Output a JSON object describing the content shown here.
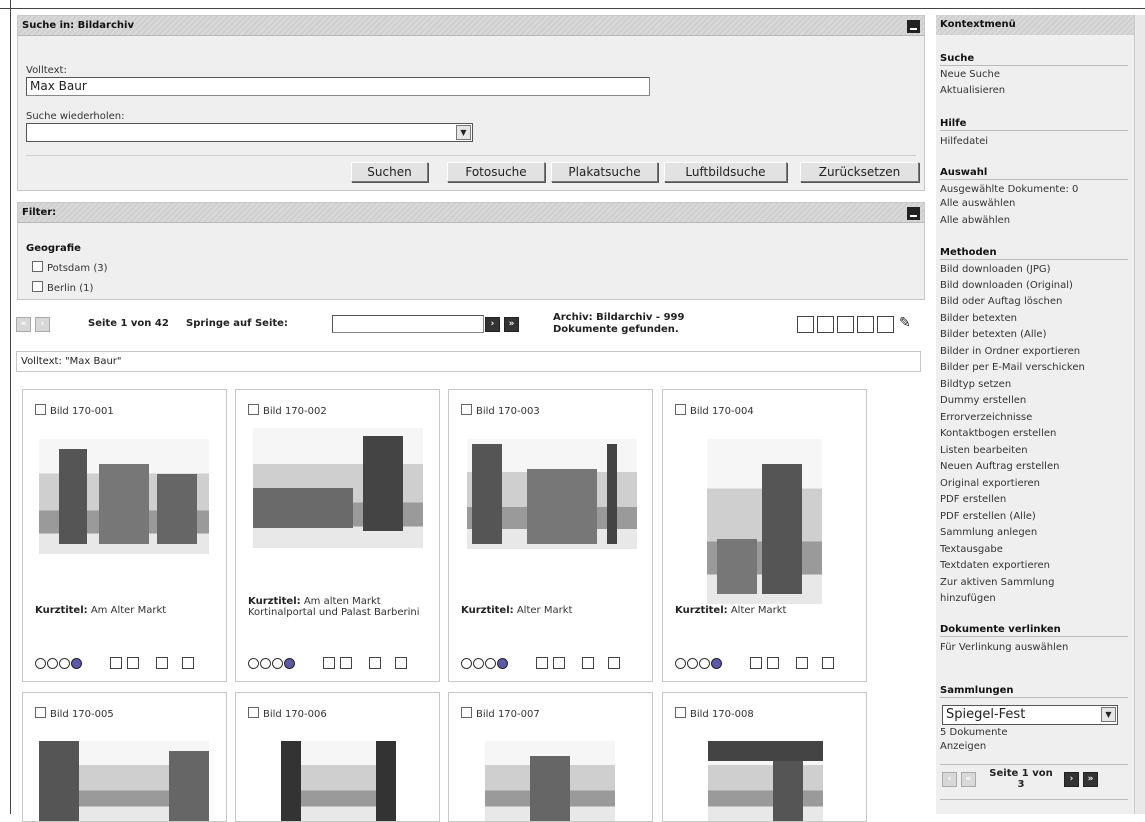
{
  "search": {
    "header": "Suche in: Bildarchiv",
    "volltext_label": "Volltext:",
    "volltext_value": "Max Baur",
    "repeat_label": "Suche wiederholen:",
    "repeat_value": "",
    "buttons": [
      "Suchen",
      "Fotosuche",
      "Plakatsuche",
      "Luftbildsuche",
      "Zurücksetzen"
    ]
  },
  "filter": {
    "header": "Filter:",
    "group_title": "Geografie",
    "options": [
      "Potsdam (3)",
      "Berlin (1)"
    ]
  },
  "pager": {
    "page_text": "Seite 1 von 42",
    "jump_label": "Springe auf Seite:",
    "archive_line1": "Archiv: Bildarchiv - 999",
    "archive_line2": "Dokumente gefunden."
  },
  "criteria": "Volltext: \"Max Baur\"",
  "results": [
    {
      "id": "Bild 170-001",
      "label": "Kurztitel:",
      "title": "Am Alter Markt"
    },
    {
      "id": "Bild 170-002",
      "label": "Kurztitel:",
      "title": "Am alten Markt Kortinalportal und Palast Barberini"
    },
    {
      "id": "Bild 170-003",
      "label": "Kurztitel:",
      "title": "Alter Markt"
    },
    {
      "id": "Bild 170-004",
      "label": "Kurztitel:",
      "title": "Alter Markt"
    },
    {
      "id": "Bild 170-005",
      "label": "",
      "title": ""
    },
    {
      "id": "Bild 170-006",
      "label": "",
      "title": ""
    },
    {
      "id": "Bild 170-007",
      "label": "",
      "title": ""
    },
    {
      "id": "Bild 170-008",
      "label": "",
      "title": ""
    }
  ],
  "sidebar": {
    "header": "Kontextmenü",
    "suche_title": "Suche",
    "suche_items": [
      "Neue Suche",
      "Aktualisieren"
    ],
    "hilfe_title": "Hilfe",
    "hilfe_items": [
      "Hilfedatei"
    ],
    "auswahl_title": "Auswahl",
    "auswahl_items": [
      "Ausgewählte Dokumente: 0",
      "Alle auswählen",
      "Alle abwählen"
    ],
    "methoden_title": "Methoden",
    "methoden_items": [
      "Bild downloaden (JPG)",
      "Bild downloaden (Original)",
      "Bild oder Auftag löschen",
      "Bilder betexten",
      "Bilder betexten (Alle)",
      "Bilder in Ordner exportieren",
      "Bilder per E-Mail verschicken",
      "Bildtyp setzen",
      "Dummy erstellen",
      "Errorverzeichnisse",
      "Kontaktbogen erstellen",
      "Listen bearbeiten",
      "Neuen Auftrag erstellen",
      "Original exportieren",
      "PDF erstellen",
      "PDF erstellen (Alle)",
      "Sammlung anlegen",
      "Textausgabe",
      "Textdaten exportieren",
      "Zur aktiven Sammlung",
      "hinzufügen"
    ],
    "verlinken_title": "Dokumente verlinken",
    "verlinken_items": [
      "Für Verlinkung auswählen"
    ],
    "sammlungen_title": "Sammlungen",
    "sammlung_selected": "Spiegel-Fest",
    "sammlung_count": "5 Dokumente",
    "sammlung_show": "Anzeigen",
    "sammlung_page": "Seite 1 von",
    "sammlung_page_total": "3"
  }
}
